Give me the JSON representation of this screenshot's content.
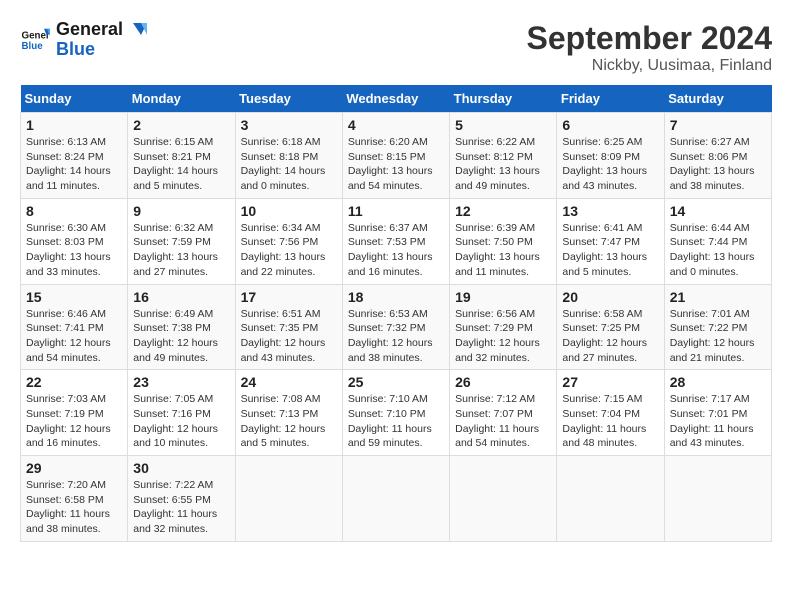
{
  "header": {
    "logo_line1": "General",
    "logo_line2": "Blue",
    "title": "September 2024",
    "subtitle": "Nickby, Uusimaa, Finland"
  },
  "columns": [
    "Sunday",
    "Monday",
    "Tuesday",
    "Wednesday",
    "Thursday",
    "Friday",
    "Saturday"
  ],
  "weeks": [
    [
      {
        "day": "1",
        "sunrise": "Sunrise: 6:13 AM",
        "sunset": "Sunset: 8:24 PM",
        "daylight": "Daylight: 14 hours and 11 minutes."
      },
      {
        "day": "2",
        "sunrise": "Sunrise: 6:15 AM",
        "sunset": "Sunset: 8:21 PM",
        "daylight": "Daylight: 14 hours and 5 minutes."
      },
      {
        "day": "3",
        "sunrise": "Sunrise: 6:18 AM",
        "sunset": "Sunset: 8:18 PM",
        "daylight": "Daylight: 14 hours and 0 minutes."
      },
      {
        "day": "4",
        "sunrise": "Sunrise: 6:20 AM",
        "sunset": "Sunset: 8:15 PM",
        "daylight": "Daylight: 13 hours and 54 minutes."
      },
      {
        "day": "5",
        "sunrise": "Sunrise: 6:22 AM",
        "sunset": "Sunset: 8:12 PM",
        "daylight": "Daylight: 13 hours and 49 minutes."
      },
      {
        "day": "6",
        "sunrise": "Sunrise: 6:25 AM",
        "sunset": "Sunset: 8:09 PM",
        "daylight": "Daylight: 13 hours and 43 minutes."
      },
      {
        "day": "7",
        "sunrise": "Sunrise: 6:27 AM",
        "sunset": "Sunset: 8:06 PM",
        "daylight": "Daylight: 13 hours and 38 minutes."
      }
    ],
    [
      {
        "day": "8",
        "sunrise": "Sunrise: 6:30 AM",
        "sunset": "Sunset: 8:03 PM",
        "daylight": "Daylight: 13 hours and 33 minutes."
      },
      {
        "day": "9",
        "sunrise": "Sunrise: 6:32 AM",
        "sunset": "Sunset: 7:59 PM",
        "daylight": "Daylight: 13 hours and 27 minutes."
      },
      {
        "day": "10",
        "sunrise": "Sunrise: 6:34 AM",
        "sunset": "Sunset: 7:56 PM",
        "daylight": "Daylight: 13 hours and 22 minutes."
      },
      {
        "day": "11",
        "sunrise": "Sunrise: 6:37 AM",
        "sunset": "Sunset: 7:53 PM",
        "daylight": "Daylight: 13 hours and 16 minutes."
      },
      {
        "day": "12",
        "sunrise": "Sunrise: 6:39 AM",
        "sunset": "Sunset: 7:50 PM",
        "daylight": "Daylight: 13 hours and 11 minutes."
      },
      {
        "day": "13",
        "sunrise": "Sunrise: 6:41 AM",
        "sunset": "Sunset: 7:47 PM",
        "daylight": "Daylight: 13 hours and 5 minutes."
      },
      {
        "day": "14",
        "sunrise": "Sunrise: 6:44 AM",
        "sunset": "Sunset: 7:44 PM",
        "daylight": "Daylight: 13 hours and 0 minutes."
      }
    ],
    [
      {
        "day": "15",
        "sunrise": "Sunrise: 6:46 AM",
        "sunset": "Sunset: 7:41 PM",
        "daylight": "Daylight: 12 hours and 54 minutes."
      },
      {
        "day": "16",
        "sunrise": "Sunrise: 6:49 AM",
        "sunset": "Sunset: 7:38 PM",
        "daylight": "Daylight: 12 hours and 49 minutes."
      },
      {
        "day": "17",
        "sunrise": "Sunrise: 6:51 AM",
        "sunset": "Sunset: 7:35 PM",
        "daylight": "Daylight: 12 hours and 43 minutes."
      },
      {
        "day": "18",
        "sunrise": "Sunrise: 6:53 AM",
        "sunset": "Sunset: 7:32 PM",
        "daylight": "Daylight: 12 hours and 38 minutes."
      },
      {
        "day": "19",
        "sunrise": "Sunrise: 6:56 AM",
        "sunset": "Sunset: 7:29 PM",
        "daylight": "Daylight: 12 hours and 32 minutes."
      },
      {
        "day": "20",
        "sunrise": "Sunrise: 6:58 AM",
        "sunset": "Sunset: 7:25 PM",
        "daylight": "Daylight: 12 hours and 27 minutes."
      },
      {
        "day": "21",
        "sunrise": "Sunrise: 7:01 AM",
        "sunset": "Sunset: 7:22 PM",
        "daylight": "Daylight: 12 hours and 21 minutes."
      }
    ],
    [
      {
        "day": "22",
        "sunrise": "Sunrise: 7:03 AM",
        "sunset": "Sunset: 7:19 PM",
        "daylight": "Daylight: 12 hours and 16 minutes."
      },
      {
        "day": "23",
        "sunrise": "Sunrise: 7:05 AM",
        "sunset": "Sunset: 7:16 PM",
        "daylight": "Daylight: 12 hours and 10 minutes."
      },
      {
        "day": "24",
        "sunrise": "Sunrise: 7:08 AM",
        "sunset": "Sunset: 7:13 PM",
        "daylight": "Daylight: 12 hours and 5 minutes."
      },
      {
        "day": "25",
        "sunrise": "Sunrise: 7:10 AM",
        "sunset": "Sunset: 7:10 PM",
        "daylight": "Daylight: 11 hours and 59 minutes."
      },
      {
        "day": "26",
        "sunrise": "Sunrise: 7:12 AM",
        "sunset": "Sunset: 7:07 PM",
        "daylight": "Daylight: 11 hours and 54 minutes."
      },
      {
        "day": "27",
        "sunrise": "Sunrise: 7:15 AM",
        "sunset": "Sunset: 7:04 PM",
        "daylight": "Daylight: 11 hours and 48 minutes."
      },
      {
        "day": "28",
        "sunrise": "Sunrise: 7:17 AM",
        "sunset": "Sunset: 7:01 PM",
        "daylight": "Daylight: 11 hours and 43 minutes."
      }
    ],
    [
      {
        "day": "29",
        "sunrise": "Sunrise: 7:20 AM",
        "sunset": "Sunset: 6:58 PM",
        "daylight": "Daylight: 11 hours and 38 minutes."
      },
      {
        "day": "30",
        "sunrise": "Sunrise: 7:22 AM",
        "sunset": "Sunset: 6:55 PM",
        "daylight": "Daylight: 11 hours and 32 minutes."
      },
      null,
      null,
      null,
      null,
      null
    ]
  ]
}
